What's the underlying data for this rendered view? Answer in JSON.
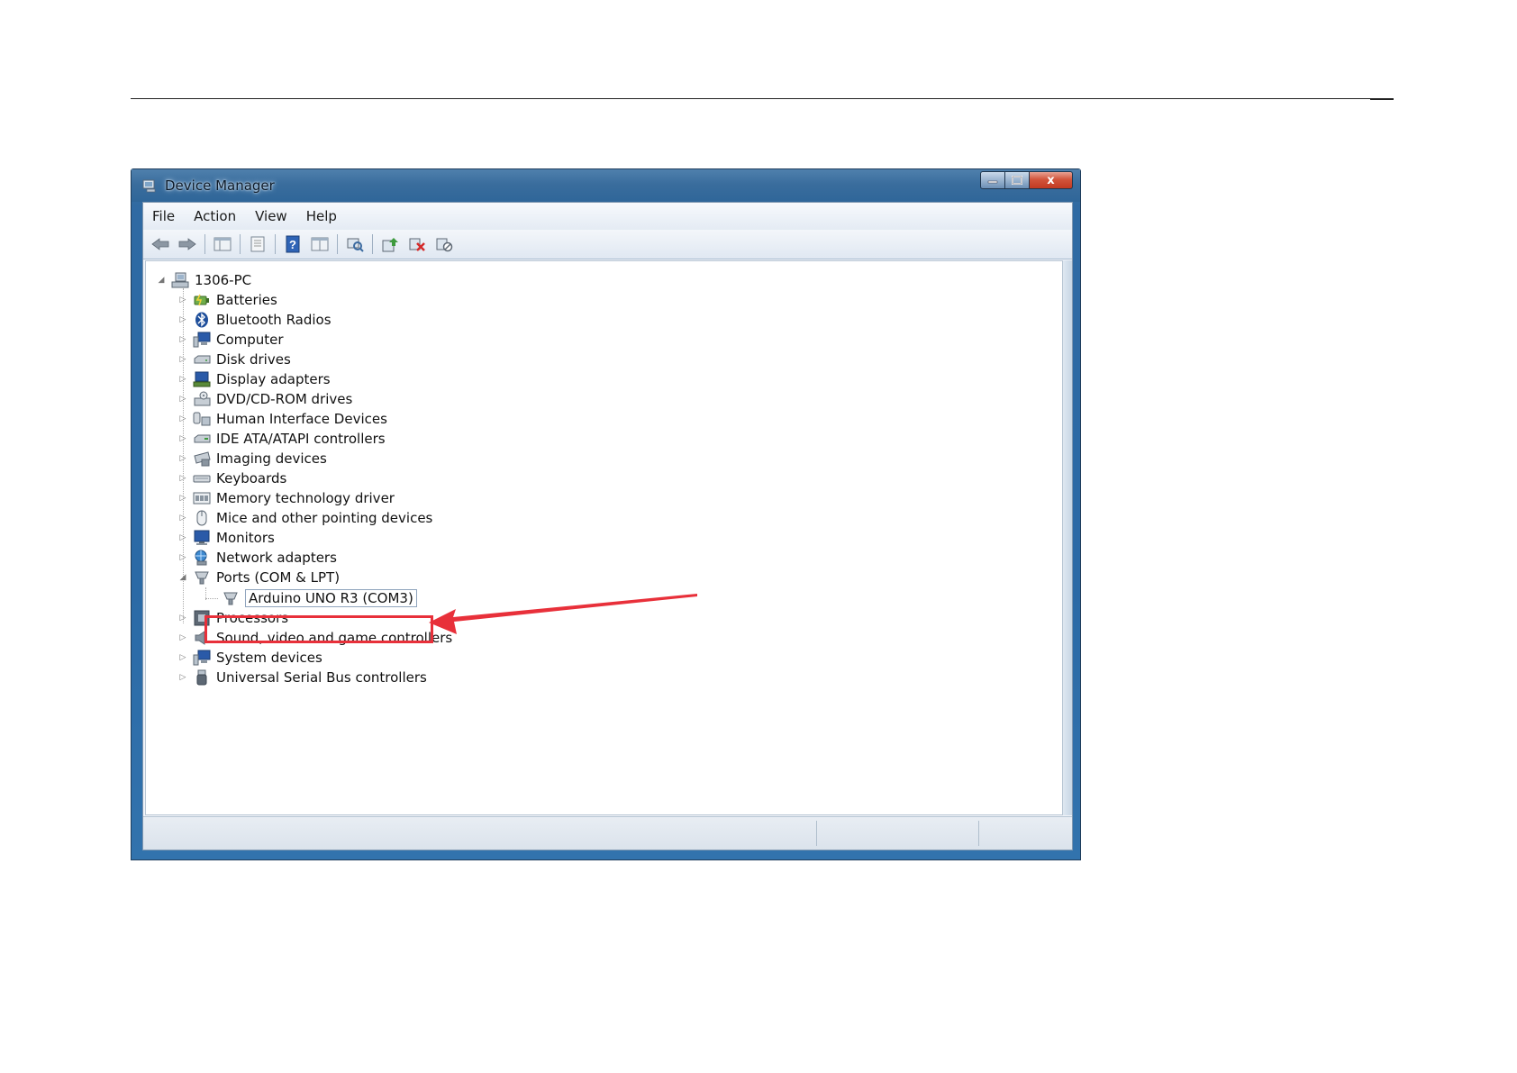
{
  "window": {
    "title": "Device Manager",
    "close_symbol": "x"
  },
  "menubar": {
    "items": [
      "File",
      "Action",
      "View",
      "Help"
    ]
  },
  "toolbar": {
    "buttons": [
      "back-icon",
      "forward-icon",
      "console-tree-icon",
      "properties-icon",
      "help-icon",
      "view-icon",
      "scan-hardware-icon",
      "update-driver-icon",
      "uninstall-icon",
      "disable-icon"
    ]
  },
  "tree": {
    "root": "1306-PC",
    "categories": [
      {
        "label": "Batteries",
        "icon": "battery-icon"
      },
      {
        "label": "Bluetooth Radios",
        "icon": "bluetooth-icon"
      },
      {
        "label": "Computer",
        "icon": "computer-icon"
      },
      {
        "label": "Disk drives",
        "icon": "disk-drive-icon"
      },
      {
        "label": "Display adapters",
        "icon": "display-adapter-icon"
      },
      {
        "label": "DVD/CD-ROM drives",
        "icon": "dvd-drive-icon"
      },
      {
        "label": "Human Interface Devices",
        "icon": "hid-icon"
      },
      {
        "label": "IDE ATA/ATAPI controllers",
        "icon": "ide-controller-icon"
      },
      {
        "label": "Imaging devices",
        "icon": "imaging-device-icon"
      },
      {
        "label": "Keyboards",
        "icon": "keyboard-icon"
      },
      {
        "label": "Memory technology driver",
        "icon": "memory-icon"
      },
      {
        "label": "Mice and other pointing devices",
        "icon": "mouse-icon"
      },
      {
        "label": "Monitors",
        "icon": "monitor-icon"
      },
      {
        "label": "Network adapters",
        "icon": "network-adapter-icon"
      },
      {
        "label": "Ports (COM & LPT)",
        "icon": "port-icon",
        "expanded": true,
        "children": [
          {
            "label": "Arduino UNO R3 (COM3)",
            "icon": "port-icon",
            "selected": true
          }
        ]
      },
      {
        "label": "Processors",
        "icon": "processor-icon"
      },
      {
        "label": "Sound, video and game controllers",
        "icon": "speaker-icon"
      },
      {
        "label": "System devices",
        "icon": "system-device-icon"
      },
      {
        "label": "Universal Serial Bus controllers",
        "icon": "usb-icon"
      }
    ]
  },
  "annotation": {
    "highlight_color": "#e8303a",
    "target": "Arduino UNO R3 (COM3)"
  },
  "colors": {
    "title_bar": "#3a6d9d",
    "close_button": "#c23a22",
    "tree_background": "#ffffff"
  }
}
